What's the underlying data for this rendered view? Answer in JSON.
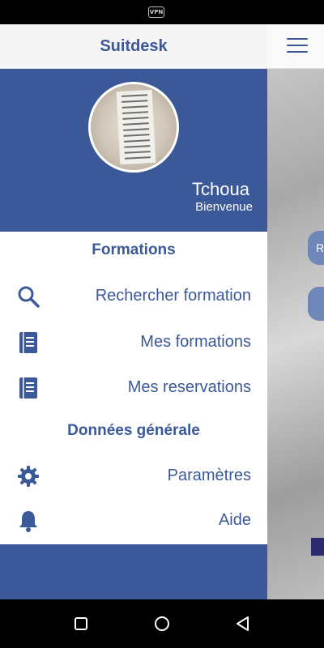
{
  "status_bar": {
    "vpn_label": "VPN"
  },
  "app": {
    "title": "Suitdesk"
  },
  "profile": {
    "name": "Tchoua",
    "subtitle": "Bienvenue"
  },
  "menu": {
    "section_formations": "Formations",
    "items_formations": [
      {
        "label": "Rechercher formation",
        "icon": "search-icon"
      },
      {
        "label": "Mes formations",
        "icon": "notebook-icon"
      },
      {
        "label": "Mes reservations",
        "icon": "notebook-icon"
      }
    ],
    "section_general": "Données générale",
    "items_general": [
      {
        "label": "Paramètres",
        "icon": "gear-icon"
      },
      {
        "label": "Aide",
        "icon": "bell-icon"
      }
    ]
  },
  "background_app": {
    "pill_letter": "R"
  },
  "colors": {
    "brand": "#3b5998",
    "background": "#ffffff"
  }
}
